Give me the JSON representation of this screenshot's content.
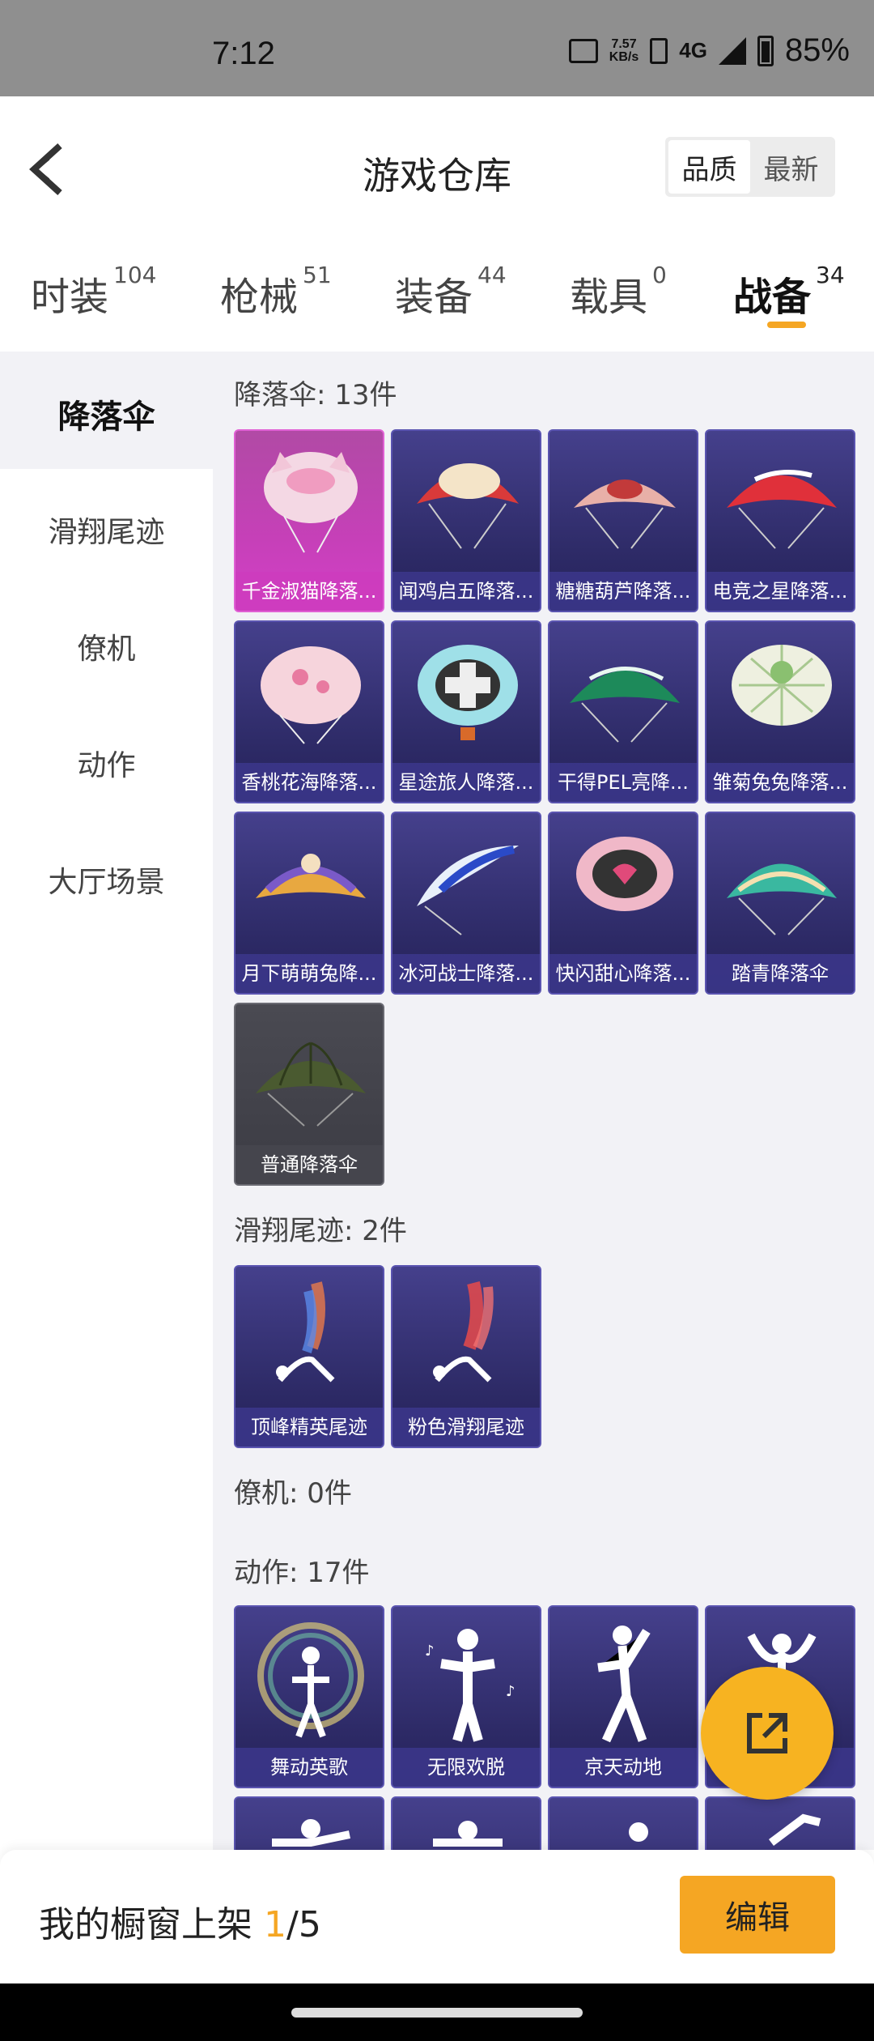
{
  "status_bar": {
    "time": "7:12",
    "net_speed_value": "7.57",
    "net_speed_unit": "KB/s",
    "network": "4G",
    "battery": "85%"
  },
  "header": {
    "title": "游戏仓库",
    "sort_options": [
      "品质",
      "最新"
    ],
    "sort_selected": "品质"
  },
  "tabs": [
    {
      "label": "时装",
      "count": "104"
    },
    {
      "label": "枪械",
      "count": "51"
    },
    {
      "label": "装备",
      "count": "44"
    },
    {
      "label": "载具",
      "count": "0"
    },
    {
      "label": "战备",
      "count": "34"
    }
  ],
  "sidebar": {
    "items": [
      "降落伞",
      "滑翔尾迹",
      "僚机",
      "动作",
      "大厅场景"
    ]
  },
  "sections": {
    "parachute": {
      "title": "降落伞: 13件",
      "items": [
        "千金淑猫降落...",
        "闻鸡启五降落...",
        "糖糖葫芦降落...",
        "电竞之星降落...",
        "香桃花海降落...",
        "星途旅人降落...",
        "干得PEL亮降...",
        "雏菊兔兔降落...",
        "月下萌萌兔降...",
        "冰河战士降落...",
        "快闪甜心降落...",
        "踏青降落伞",
        "普通降落伞"
      ]
    },
    "trail": {
      "title": "滑翔尾迹: 2件",
      "items": [
        "顶峰精英尾迹",
        "粉色滑翔尾迹"
      ]
    },
    "wingman": {
      "title": "僚机: 0件"
    },
    "emote": {
      "title": "动作: 17件",
      "items": [
        "舞动英歌",
        "无限欢脱",
        "京天动地",
        ""
      ]
    }
  },
  "bottom": {
    "showcase_label": "我的橱窗上架 ",
    "showcase_current": "1",
    "showcase_total": "/5",
    "edit_label": "编辑"
  },
  "colors": {
    "accent": "#f5a623",
    "card_bg": "#3a3680",
    "card_pink": "#cc44c0"
  }
}
